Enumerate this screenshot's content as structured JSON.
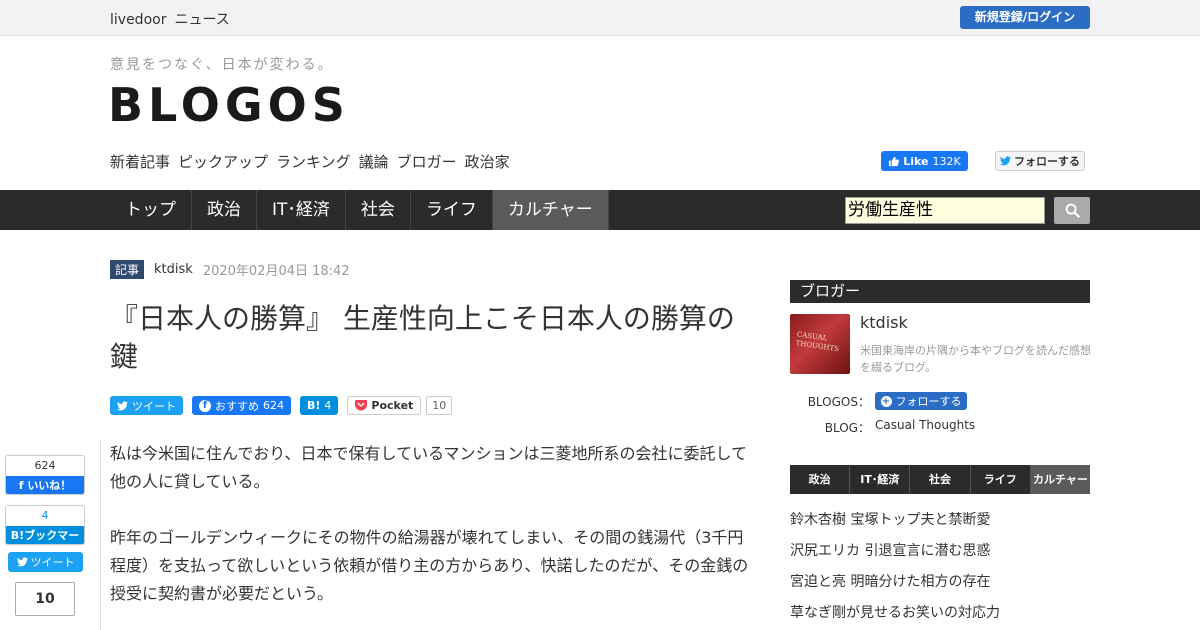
{
  "header": {
    "brand": "livedoor",
    "brand_news": "ニュース",
    "login_label": "新規登録/ログイン"
  },
  "site": {
    "tagline": "意見をつなぐ、日本が変わる。",
    "logo": "BLOGOS"
  },
  "subnav": [
    "新着記事",
    "ピックアップ",
    "ランキング",
    "議論",
    "ブロガー",
    "政治家"
  ],
  "social_top": {
    "fb_like_label": "Like",
    "fb_like_count": "132K",
    "tw_follow_label": "フォローする"
  },
  "mainnav": {
    "items": [
      "トップ",
      "政治",
      "IT･経済",
      "社会",
      "ライフ",
      "カルチャー"
    ],
    "active": "カルチャー"
  },
  "search": {
    "value": "労働生産性"
  },
  "article": {
    "badge": "記事",
    "author": "ktdisk",
    "date": "2020年02月04日 18:42",
    "title": "『日本人の勝算』 生産性向上こそ日本人の勝算の鍵",
    "paragraphs": [
      "私は今米国に住んでおり、日本で保有しているマンションは三菱地所系の会社に委託して他の人に貸している。",
      "昨年のゴールデンウィークにその物件の給湯器が壊れてしまい、その間の銭湯代（3千円程度）を支払って欲しいという依頼が借り主の方からあり、快諾したのだが、その金銭の授受に契約書が必要だという。"
    ]
  },
  "share": {
    "tweet_label": "ツイート",
    "fb_label": "おすすめ",
    "fb_count": "624",
    "hb_label": "B!",
    "hb_count": "4",
    "pocket_label": "Pocket",
    "pocket_count": "10"
  },
  "left_social": {
    "fb_count": "624",
    "fb_label": "いいね！",
    "hb_count": "4",
    "hb_label": "B!ブックマーク",
    "tweet_label": "ツイート",
    "pocket_count": "10"
  },
  "sidebar": {
    "heading": "ブロガー",
    "blogger_name": "ktdisk",
    "blogger_desc": "米国東海岸の片隅から本やブログを読んだ感想を綴るブログ。",
    "avatar_text": "CASUAL THOUGHTS",
    "blogos_label": "BLOGOS：",
    "follow_label": "フォローする",
    "blog_label": "BLOG：",
    "blog_name": "Casual Thoughts",
    "tabs": [
      "政治",
      "IT･経済",
      "社会",
      "ライフ",
      "カルチャー"
    ],
    "active_tab": "カルチャー",
    "ranking": [
      "鈴木杏樹 宝塚トップ夫と禁断愛",
      "沢尻エリカ 引退宣言に潜む思惑",
      "宮迫と亮 明暗分けた相方の存在",
      "草なぎ剛が見せるお笑いの対応力"
    ]
  },
  "colors": {
    "login_blue": "#2b6cc4",
    "nav_dark": "#2b2b2b",
    "nav_active": "#5a5a5a",
    "twitter": "#1da1f2",
    "facebook": "#1877f2",
    "hatena": "#008fde",
    "pocket": "#ef4056"
  }
}
